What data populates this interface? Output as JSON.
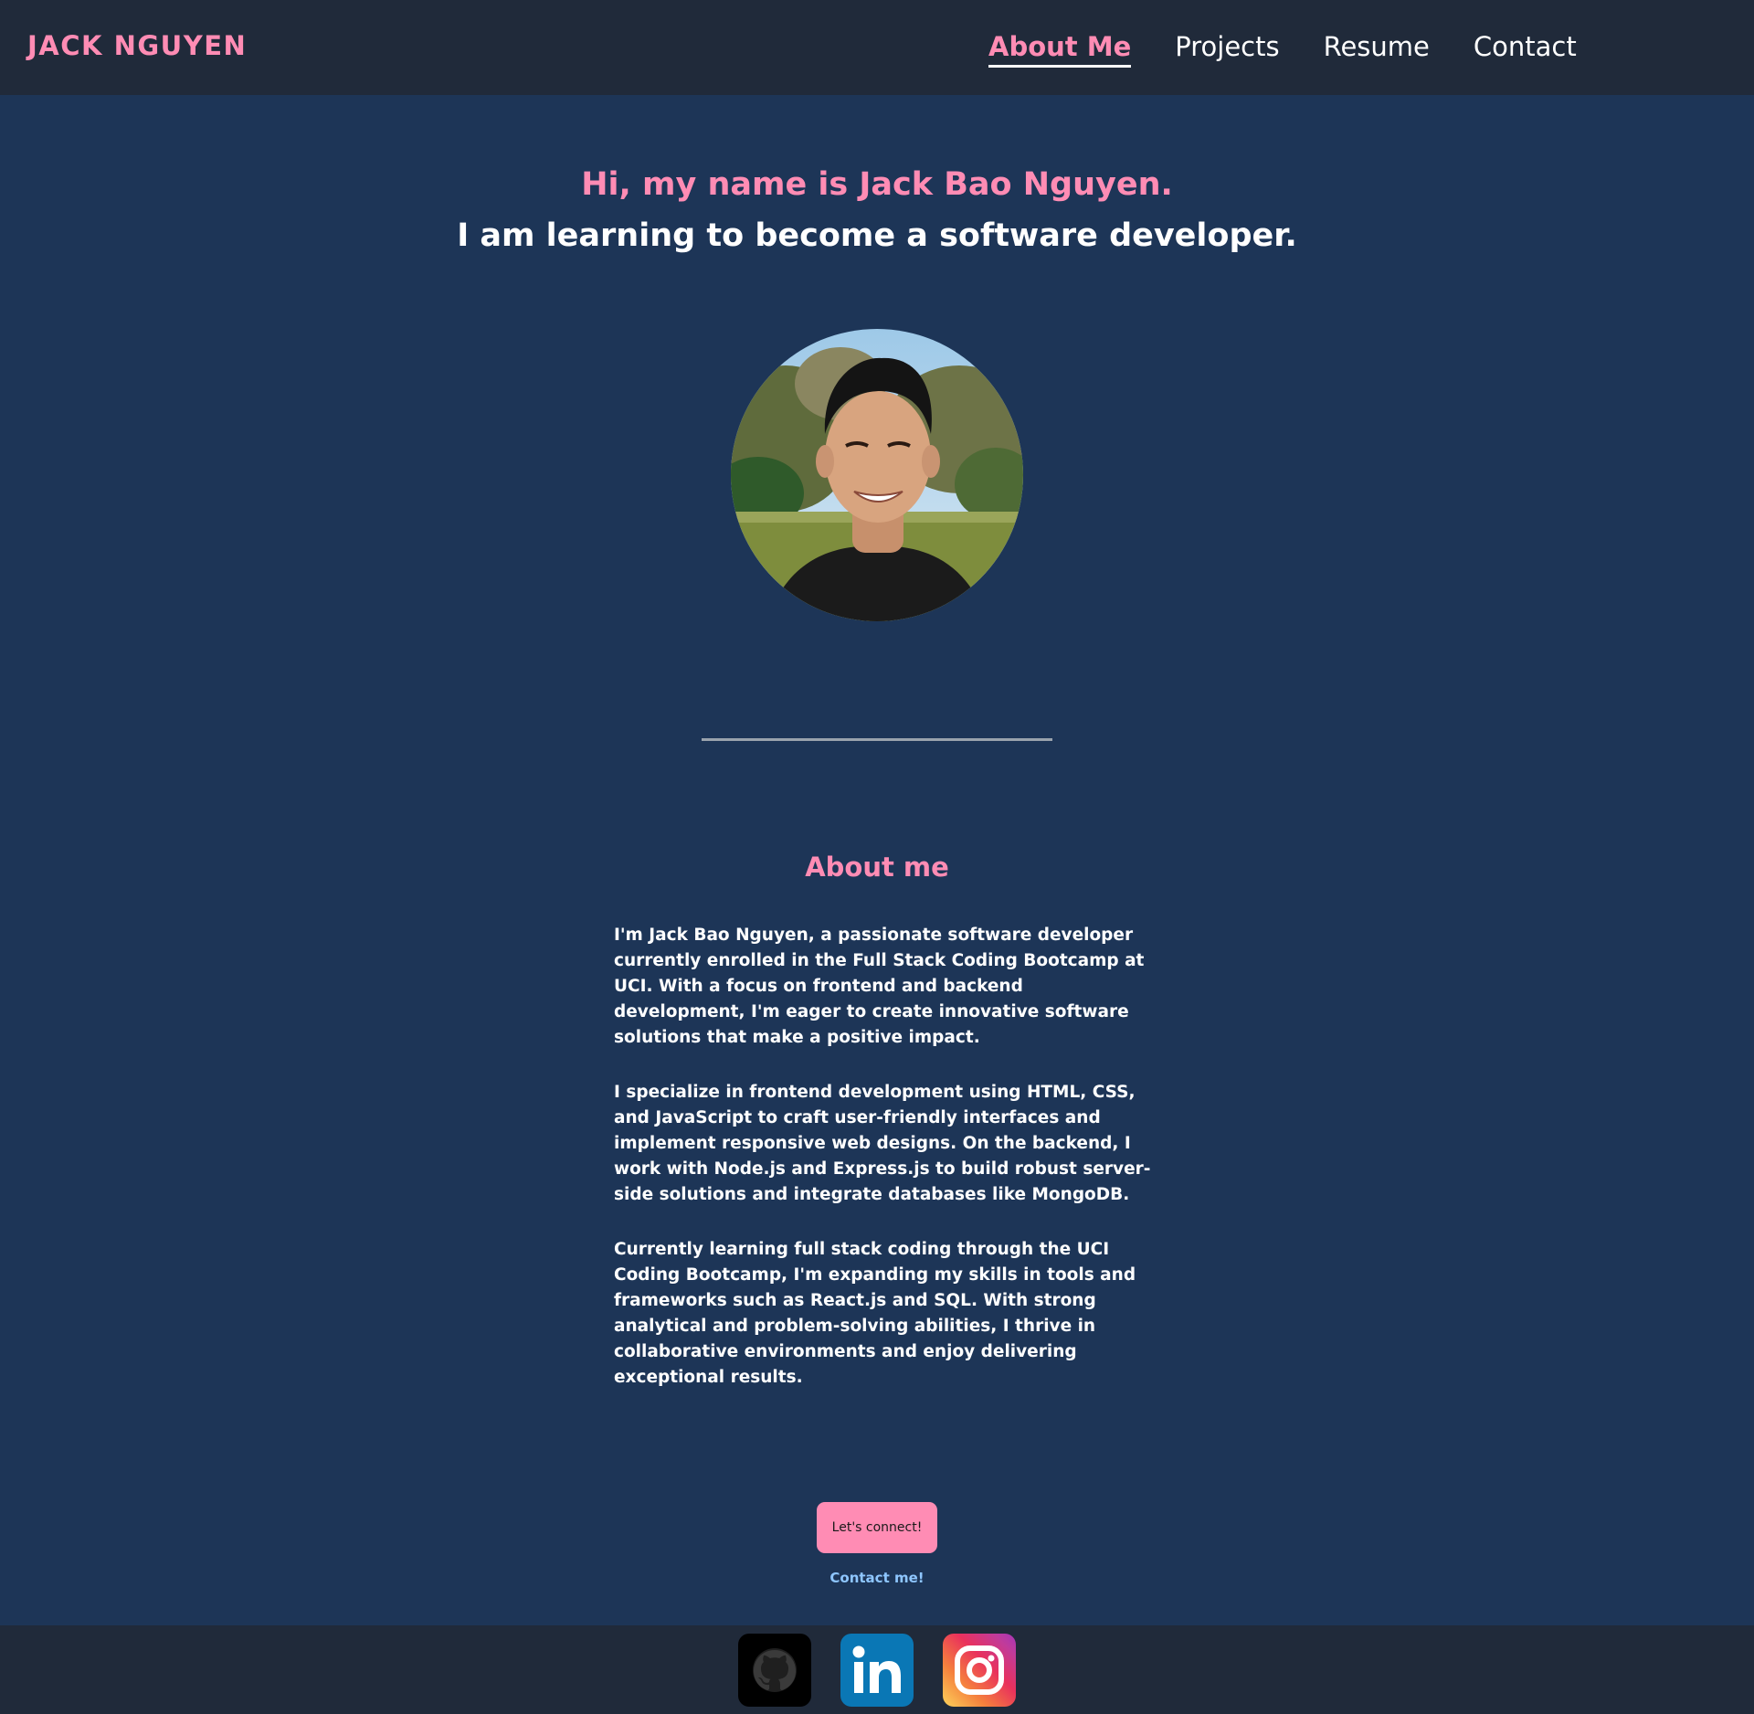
{
  "header": {
    "brand": "JACK NGUYEN",
    "nav": [
      {
        "label": "About Me",
        "active": true
      },
      {
        "label": "Projects",
        "active": false
      },
      {
        "label": "Resume",
        "active": false
      },
      {
        "label": "Contact",
        "active": false
      }
    ]
  },
  "hero": {
    "title": "Hi, my name is Jack Bao Nguyen.",
    "subtitle": "I am learning to become a software developer."
  },
  "about": {
    "heading": "About me",
    "paragraphs": [
      "I'm Jack Bao Nguyen, a passionate software developer currently enrolled in the Full Stack Coding Bootcamp at UCI. With a focus on frontend and backend development, I'm eager to create innovative software solutions that make a positive impact.",
      "I specialize in frontend development using HTML, CSS, and JavaScript to craft user-friendly interfaces and implement responsive web designs. On the backend, I work with Node.js and Express.js to build robust server-side solutions and integrate databases like MongoDB.",
      "Currently learning full stack coding through the UCI Coding Bootcamp, I'm expanding my skills in tools and frameworks such as React.js and SQL. With strong analytical and problem-solving abilities, I thrive in collaborative environments and enjoy delivering exceptional results."
    ]
  },
  "connect": {
    "button_label": "Let's connect!",
    "link_label": "Contact me!"
  },
  "footer": {
    "socials": [
      {
        "icon": "github-icon"
      },
      {
        "icon": "linkedin-icon"
      },
      {
        "icon": "instagram-icon"
      }
    ]
  },
  "colors": {
    "accent": "#ff8cb4",
    "background": "#1d3557",
    "header_footer": "#202a3a",
    "link": "#8ec6ff"
  }
}
